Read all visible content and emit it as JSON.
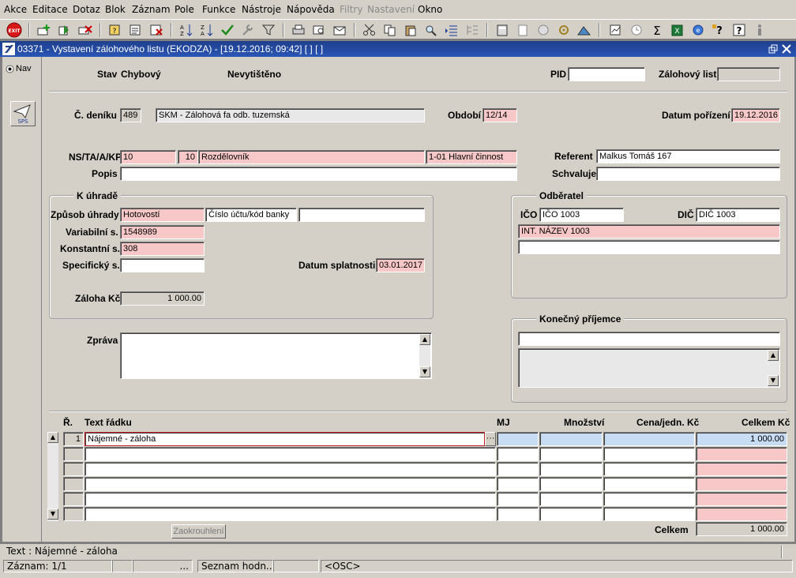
{
  "menu": {
    "items": [
      "Akce",
      "Editace",
      "Dotaz",
      "Blok",
      "Záznam",
      "Pole",
      "Funkce",
      "Nástroje",
      "Nápověda",
      "Filtry",
      "Nastavení",
      "Okno"
    ],
    "disabled": [
      "Filtry",
      "Nastavení"
    ]
  },
  "toolbar": {
    "exit_label": "EXIT"
  },
  "window": {
    "title": "03371 - Vystavení zálohového listu (EKODZA) - [19.12.2016; 09:42]  [ ]  [ ]"
  },
  "left_pane": {
    "nav_label": "Nav",
    "sps_label": "SPS"
  },
  "header": {
    "stav_label": "Stav",
    "stav_value": "Chybový",
    "print_status": "Nevytištěno",
    "pid_label": "PID",
    "pid_value": "",
    "zalohovy_list_label": "Zálohový list",
    "zalohovy_list_value": ""
  },
  "denik": {
    "label": "Č. deníku",
    "number": "489",
    "name": "SKM - Zálohová fa odb. tuzemská",
    "obdobi_label": "Období",
    "obdobi_value": "12/14",
    "datum_porizeni_label": "Datum pořízení",
    "datum_porizeni_value": "19.12.2016"
  },
  "nstakp": {
    "label": "NS/TA/A/KP",
    "ns": "10",
    "ta": "10",
    "ta_name": "Rozdělovník",
    "kp": "1-01 Hlavní činnost",
    "referent_label": "Referent",
    "referent_value": "Malkus Tomáš 167",
    "popis_label": "Popis",
    "popis_value": "",
    "schvaluje_label": "Schvaluje",
    "schvaluje_value": ""
  },
  "k_uhrade": {
    "title": "K úhradě",
    "zpusob_label": "Způsob úhrady",
    "zpusob_value": "Hotovostí",
    "ucet_label": "Číslo účtu/kód banky",
    "ucet_value": "",
    "variabilni_label": "Variabilní s.",
    "variabilni_value": "1548989",
    "konstantni_label": "Konstantní s.",
    "konstantni_value": "308",
    "specificky_label": "Specifický s.",
    "specificky_value": "",
    "splatnost_label": "Datum splatnosti",
    "splatnost_value": "03.01.2017",
    "zaloha_label": "Záloha Kč",
    "zaloha_value": "1 000.00"
  },
  "odberatel": {
    "title": "Odběratel",
    "ico_label": "IČO",
    "ico_value": "IČO 1003",
    "dic_label": "DIČ",
    "dic_value": "DIČ 1003",
    "name": "INT. NÁZEV 1003",
    "line2": ""
  },
  "zprava": {
    "label": "Zpráva",
    "value": ""
  },
  "konecny": {
    "title": "Konečný příjemce",
    "line1": "",
    "area": ""
  },
  "table": {
    "headers": {
      "r": "Ř.",
      "text": "Text řádku",
      "mj": "MJ",
      "mnozstvi": "Množství",
      "cena": "Cena/jedn. Kč",
      "celkem": "Celkem Kč"
    },
    "rows": [
      {
        "r": "1",
        "text": "Nájemné - záloha",
        "mj": "",
        "mnozstvi": "",
        "cena": "",
        "celkem": "1 000.00"
      },
      {
        "r": "",
        "text": "",
        "mj": "",
        "mnozstvi": "",
        "cena": "",
        "celkem": ""
      },
      {
        "r": "",
        "text": "",
        "mj": "",
        "mnozstvi": "",
        "cena": "",
        "celkem": ""
      },
      {
        "r": "",
        "text": "",
        "mj": "",
        "mnozstvi": "",
        "cena": "",
        "celkem": ""
      },
      {
        "r": "",
        "text": "",
        "mj": "",
        "mnozstvi": "",
        "cena": "",
        "celkem": ""
      },
      {
        "r": "",
        "text": "",
        "mj": "",
        "mnozstvi": "",
        "cena": "",
        "celkem": ""
      }
    ],
    "zaokrouhleni_label": "Zaokrouhlení",
    "celkem_label": "Celkem",
    "celkem_value": "1 000.00"
  },
  "status": {
    "text_line": "Text : Nájemné - záloha",
    "zaznam": "Záznam: 1/1",
    "cell3": "...",
    "seznam": "Seznam hodn...",
    "osc": "<OSC>"
  },
  "colors": {
    "pink": "#f8c8c8",
    "title_bar": "#2a56b6",
    "selected_row": "#c8dcf4"
  }
}
